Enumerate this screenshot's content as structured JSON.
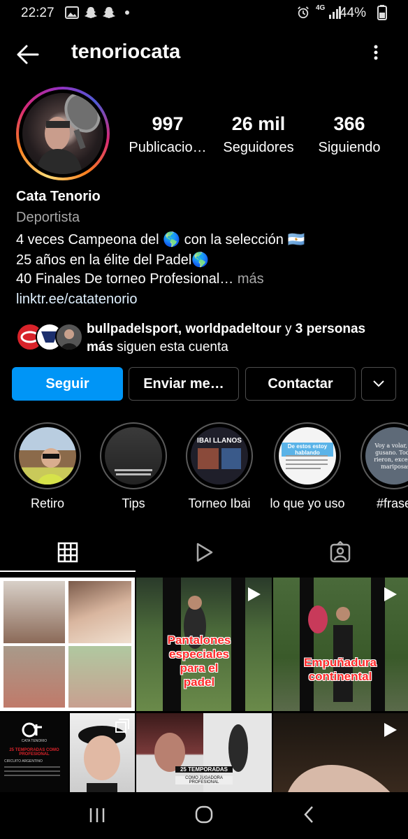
{
  "status_bar": {
    "time": "22:27",
    "network": "4G",
    "battery": "44%"
  },
  "header": {
    "username": "tenoriocata"
  },
  "stats": [
    {
      "number": "997",
      "label": "Publicacio…"
    },
    {
      "number": "26 mil",
      "label": "Seguidores"
    },
    {
      "number": "366",
      "label": "Siguiendo"
    }
  ],
  "bio": {
    "name": "Cata Tenorio",
    "category": "Deportista",
    "line1": "4 veces Campeona del 🌎 con la selección 🇦🇷",
    "line2": "25 años en la élite del Padel🌎",
    "line3": "40 Finales De torneo Profesional…",
    "more": " más",
    "link": "linktr.ee/catatenorio"
  },
  "followed_by": {
    "accounts": "bullpadelsport, worldpadeltour",
    "connector": " y ",
    "others": "3 personas más",
    "suffix": " siguen esta cuenta"
  },
  "buttons": {
    "follow": "Seguir",
    "message": "Enviar me…",
    "contact": "Contactar"
  },
  "highlights": [
    {
      "label": "Retiro"
    },
    {
      "label": "Tips"
    },
    {
      "label": "Torneo Ibai",
      "cover_text": "IBAI LLANOS"
    },
    {
      "label": "lo que yo uso",
      "cover_text": "De estos estoy hablando"
    },
    {
      "label": "#frase",
      "cover_text": "Voy a volar, dij gusano. Todos rieron, excepto mariposas"
    }
  ],
  "tabs": [
    "grid-icon",
    "reels-icon",
    "tagged-icon"
  ],
  "posts": [
    {
      "type": "collage"
    },
    {
      "type": "reel",
      "overlay_text": "Pantalones especiales para el padel"
    },
    {
      "type": "reel",
      "overlay_text": "Empuñadura continental"
    },
    {
      "type": "image",
      "overlay_text": "25 TEMPORADAS COMO PROFESIONAL",
      "logo": "CATA TENORIO",
      "subtext": "CIRCUITO ARGENTINO"
    },
    {
      "type": "carousel"
    },
    {
      "type": "image",
      "overlay_text": "25 TEMPORADAS",
      "subtext": "COMO JUGADORA PROFESIONAL"
    },
    {
      "type": "reel"
    }
  ],
  "colors": {
    "accent": "#0095f6",
    "background": "#000000",
    "secondary_text": "#a8a8a8"
  }
}
